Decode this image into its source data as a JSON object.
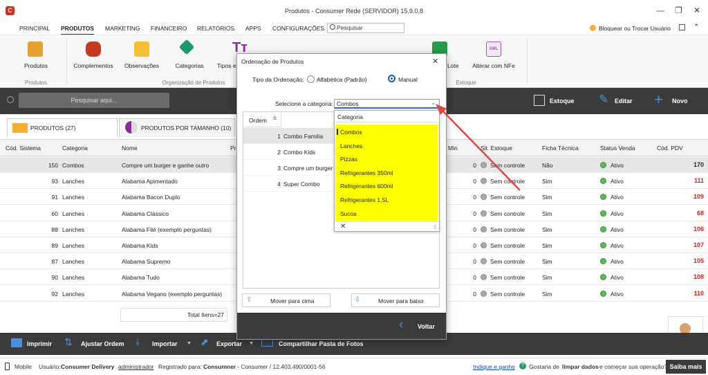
{
  "window": {
    "title": "Produtos - Consumer Rede (SERVIDOR) 15.9.0.8",
    "logo_letter": "C",
    "minimize": "—",
    "restore": "❐",
    "close": "✕"
  },
  "menu": [
    "PRINCIPAL",
    "PRODUTOS",
    "MARKETING",
    "FINANCEIRO",
    "RELATÓRIOS",
    "APPS",
    "CONFIGURAÇÕES"
  ],
  "search_placeholder": "Pesquisar",
  "lock_label": "Bloquear ou Trocar Usuário",
  "ribbon": {
    "items": [
      "Produtos",
      "Complementos",
      "Observações",
      "Categorias",
      "Tipos e",
      "Lote",
      "Alterar com NFe"
    ],
    "groups": [
      "Produtos",
      "Organização de Produtos",
      "Estoque"
    ],
    "xml_badge": "XML"
  },
  "toolbar": {
    "search_placeholder": "Pesquisar aqui...",
    "estoque": "Estoque",
    "editar": "Editar",
    "novo": "Novo"
  },
  "tabs": [
    "PRODUTOS (27)",
    "PRODUTOS POR TAMANHO (10)"
  ],
  "grid": {
    "headers": [
      "Cód. Sistema",
      "Categoria",
      "Nome",
      "Pr",
      "Min",
      "Sit. Estoque",
      "Ficha Técnica",
      "Status Venda",
      "Cód. PDV"
    ],
    "rows": [
      {
        "cod": "150",
        "cat": "Combos",
        "nome": "Compre um burger e ganhe outro",
        "min": "0",
        "sit": "Sem controle",
        "ficha": "Não",
        "status": "Ativo",
        "pdv": "170"
      },
      {
        "cod": "93",
        "cat": "Lanches",
        "nome": "Alabama Apimentado",
        "min": "0",
        "sit": "Sem controle",
        "ficha": "Sim",
        "status": "Ativo",
        "pdv": "111"
      },
      {
        "cod": "91",
        "cat": "Lanches",
        "nome": "Alabama Bacon Duplo",
        "min": "0",
        "sit": "Sem controle",
        "ficha": "Sim",
        "status": "Ativo",
        "pdv": "109"
      },
      {
        "cod": "60",
        "cat": "Lanches",
        "nome": "Alabama Clássico",
        "min": "0",
        "sit": "Sem controle",
        "ficha": "Sim",
        "status": "Ativo",
        "pdv": "68"
      },
      {
        "cod": "88",
        "cat": "Lanches",
        "nome": "Alabama Filé (exemplo perguntas)",
        "min": "0",
        "sit": "Sem controle",
        "ficha": "Sim",
        "status": "Ativo",
        "pdv": "106"
      },
      {
        "cod": "89",
        "cat": "Lanches",
        "nome": "Alabama Kids",
        "min": "0",
        "sit": "Sem controle",
        "ficha": "Sim",
        "status": "Ativo",
        "pdv": "107"
      },
      {
        "cod": "87",
        "cat": "Lanches",
        "nome": "Alabama Supremo",
        "min": "0",
        "sit": "Sem controle",
        "ficha": "Sim",
        "status": "Ativo",
        "pdv": "105"
      },
      {
        "cod": "90",
        "cat": "Lanches",
        "nome": "Alabama Tudo",
        "min": "0",
        "sit": "Sem controle",
        "ficha": "Sim",
        "status": "Ativo",
        "pdv": "108"
      },
      {
        "cod": "92",
        "cat": "Lanches",
        "nome": "Alabama Vegano (exemplo perguntas)",
        "min": "0",
        "sit": "Sem controle",
        "ficha": "Sim",
        "status": "Ativo",
        "pdv": "110"
      }
    ],
    "total": "Total Itens=27"
  },
  "bottom": {
    "imprimir": "Imprimir",
    "ajustar": "Ajustar Ordem",
    "importar": "Importar",
    "exportar": "Exportar",
    "compartilhar": "Compartilhar Pasta de Fotos"
  },
  "status": {
    "mobile": "Mobile",
    "usuario_label": "Usuário:",
    "usuario": "Consumer Delivery",
    "admin": "administrador",
    "registrado_label": "Registrado para:",
    "registrado": "Consumner",
    "registrado_rest": "- Consumer / 12.403.490/0001-56",
    "indique": "Indique e ganhe",
    "gostaria_1": "Gostaria de",
    "gostaria_bold": "limpar dados",
    "gostaria_2": "e começar sua operação?",
    "saiba": "Saiba mais"
  },
  "dialog": {
    "title": "Ordenação de Produtos",
    "tipo_label": "Tipo da Ordenação:",
    "opt_alfa": "Alfabética (Padrão)",
    "opt_manual": "Manual",
    "categoria_label": "Selecione a categoria:",
    "categoria_value": "Combos",
    "list_header": "Ordem",
    "items": [
      {
        "n": "1",
        "name": "Combo Familia"
      },
      {
        "n": "2",
        "name": "Combo Kids"
      },
      {
        "n": "3",
        "name": "Compre um burger e"
      },
      {
        "n": "4",
        "name": "Super Combo"
      }
    ],
    "mover_cima": "Mover para cima",
    "mover_baixo": "Mover para baixo",
    "voltar": "Voltar"
  },
  "dropdown": {
    "header": "Categoria",
    "options": [
      "Combos",
      "Lanches",
      "Pizzas",
      "Refrigerantes 350ml",
      "Refrigerantes 600ml",
      "Refrigerantes 1,5L",
      "Sucos"
    ],
    "clear": "✕"
  },
  "colors": {
    "accent": "#1a5ab8",
    "dark": "#3b3b3b",
    "pdv_red": "#d32020",
    "highlight": "#ffff00",
    "arrow": "#e04545"
  }
}
